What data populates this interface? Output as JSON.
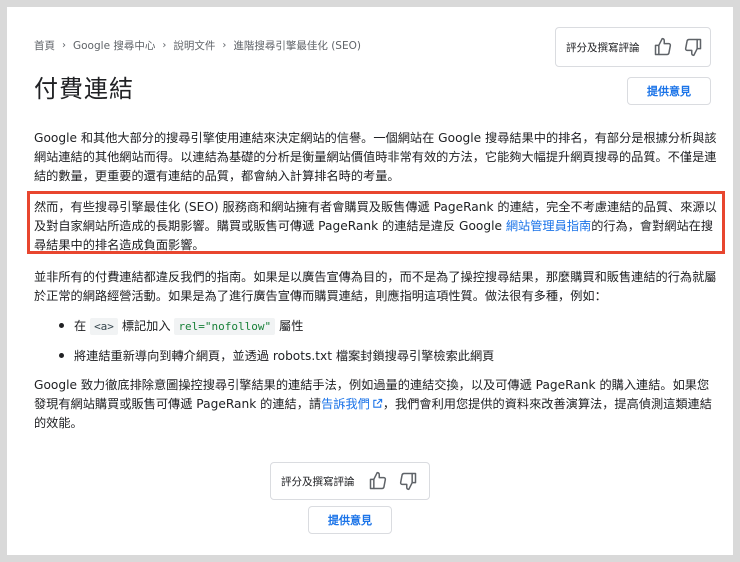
{
  "breadcrumb": {
    "items": [
      "首頁",
      "Google 搜尋中心",
      "說明文件",
      "進階搜尋引擎最佳化 (SEO)"
    ],
    "separator": "›"
  },
  "rating": {
    "label": "評分及撰寫評論"
  },
  "feedback": {
    "label": "提供意見"
  },
  "title": "付費連結",
  "paragraphs": {
    "p1": "Google 和其他大部分的搜尋引擎使用連結來決定網站的信譽。一個網站在 Google 搜尋結果中的排名，有部分是根據分析與該網站連結的其他網站而得。以連結為基礎的分析是衡量網站價值時非常有效的方法，它能夠大幅提升網頁搜尋的品質。不僅是連結的數量，更重要的還有連結的品質，都會納入計算排名時的考量。",
    "p2_before": "然而，有些搜尋引擎最佳化 (SEO) 服務商和網站擁有者會購買及販售傳遞 PageRank 的連結，完全不考慮連結的品質、來源以及對自家網站所造成的長期影響。購買或販售可傳遞 PageRank 的連結是違反 Google ",
    "p2_link": "網站管理員指南",
    "p2_after": "的行為，會對網站在搜尋結果中的排名造成負面影響。",
    "p3": "並非所有的付費連結都違反我們的指南。如果是以廣告宣傳為目的，而不是為了操控搜尋結果，那麼購買和販售連結的行為就屬於正常的網路經營活動。如果是為了進行廣告宣傳而購買連結，則應指明這項性質。做法很有多種，例如：",
    "p4_before": "Google 致力徹底排除意圖操控搜尋引擎結果的連結手法，例如過量的連結交換，以及可傳遞 PageRank 的購入連結。如果您發現有網站購買或販售可傳遞 PageRank 的連結，請",
    "p4_link": "告訴我們",
    "p4_after": "，我們會利用您提供的資料來改善演算法，提高偵測這類連結的效能。"
  },
  "bullets": {
    "b1_prefix": "在",
    "b1_code_tag": "<a>",
    "b1_mid": "標記加入",
    "b1_code_rel": "rel=\"nofollow\"",
    "b1_suffix": "屬性",
    "b2": "將連結重新導向到轉介網頁，並透過 robots.txt 檔案封鎖搜尋引擎檢索此網頁"
  },
  "colors": {
    "link": "#1a73e8",
    "highlight_border": "#e8462f",
    "text": "#202124"
  },
  "icons": [
    "chevron-right-icon",
    "thumb-up-icon",
    "thumb-down-icon",
    "external-link-icon"
  ]
}
